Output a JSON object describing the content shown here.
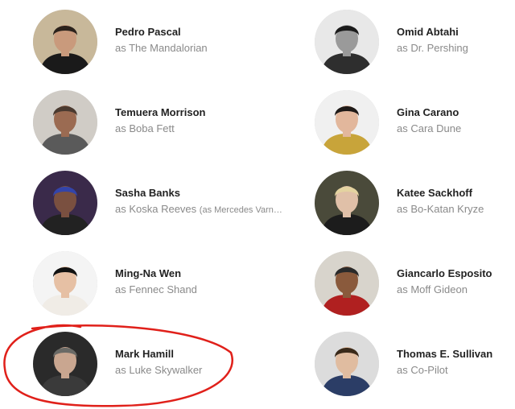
{
  "cast": [
    {
      "name": "Pedro Pascal",
      "role": "as The Mandalorian",
      "note": "",
      "avatar_icon": "actor-photo-icon",
      "colors": {
        "bg": "#c8b89a",
        "hair": "#2b221c",
        "skin": "#c99a7c",
        "clothes": "#1a1a1a"
      }
    },
    {
      "name": "Omid Abtahi",
      "role": "as Dr. Pershing",
      "note": "",
      "avatar_icon": "actor-photo-icon",
      "colors": {
        "bg": "#e8e8e8",
        "hair": "#1b1b1b",
        "skin": "#9a9a9a",
        "clothes": "#2e2e2e"
      }
    },
    {
      "name": "Temuera Morrison",
      "role": "as Boba Fett",
      "note": "",
      "avatar_icon": "actor-photo-icon",
      "colors": {
        "bg": "#d0ccc6",
        "hair": "#4a3a30",
        "skin": "#9b6b52",
        "clothes": "#5a5a5a"
      }
    },
    {
      "name": "Gina Carano",
      "role": "as Cara Dune",
      "note": "",
      "avatar_icon": "actor-photo-icon",
      "colors": {
        "bg": "#f0f0f0",
        "hair": "#1f1a18",
        "skin": "#e2b79c",
        "clothes": "#c8a43a"
      }
    },
    {
      "name": "Sasha Banks",
      "role": "as Koska Reeves",
      "note": "(as Mercedes Varn…",
      "avatar_icon": "actor-photo-icon",
      "colors": {
        "bg": "#3a2a4a",
        "hair": "#3344aa",
        "skin": "#7a5040",
        "clothes": "#222222"
      }
    },
    {
      "name": "Katee Sackhoff",
      "role": "as Bo-Katan Kryze",
      "note": "",
      "avatar_icon": "actor-photo-icon",
      "colors": {
        "bg": "#4a4a3a",
        "hair": "#e4d3a0",
        "skin": "#e0c0a8",
        "clothes": "#1c1c1c"
      }
    },
    {
      "name": "Ming-Na Wen",
      "role": "as Fennec Shand",
      "note": "",
      "avatar_icon": "actor-photo-icon",
      "colors": {
        "bg": "#f4f4f4",
        "hair": "#111111",
        "skin": "#e6c0a4",
        "clothes": "#f0ece6"
      }
    },
    {
      "name": "Giancarlo Esposito",
      "role": "as Moff Gideon",
      "note": "",
      "avatar_icon": "actor-photo-icon",
      "colors": {
        "bg": "#d8d4cc",
        "hair": "#2a2a2a",
        "skin": "#8a5a3c",
        "clothes": "#b02020"
      }
    },
    {
      "name": "Mark Hamill",
      "role": "as Luke Skywalker",
      "note": "",
      "avatar_icon": "actor-photo-icon",
      "colors": {
        "bg": "#2a2a2a",
        "hair": "#6a6a66",
        "skin": "#c9a690",
        "clothes": "#3a3a3a"
      }
    },
    {
      "name": "Thomas E. Sullivan",
      "role": "as Co-Pilot",
      "note": "",
      "avatar_icon": "actor-photo-icon",
      "colors": {
        "bg": "#dcdcdc",
        "hair": "#3a2a1a",
        "skin": "#e0bca0",
        "clothes": "#2b3d66"
      }
    }
  ],
  "annotation": {
    "color": "#e0201a"
  }
}
